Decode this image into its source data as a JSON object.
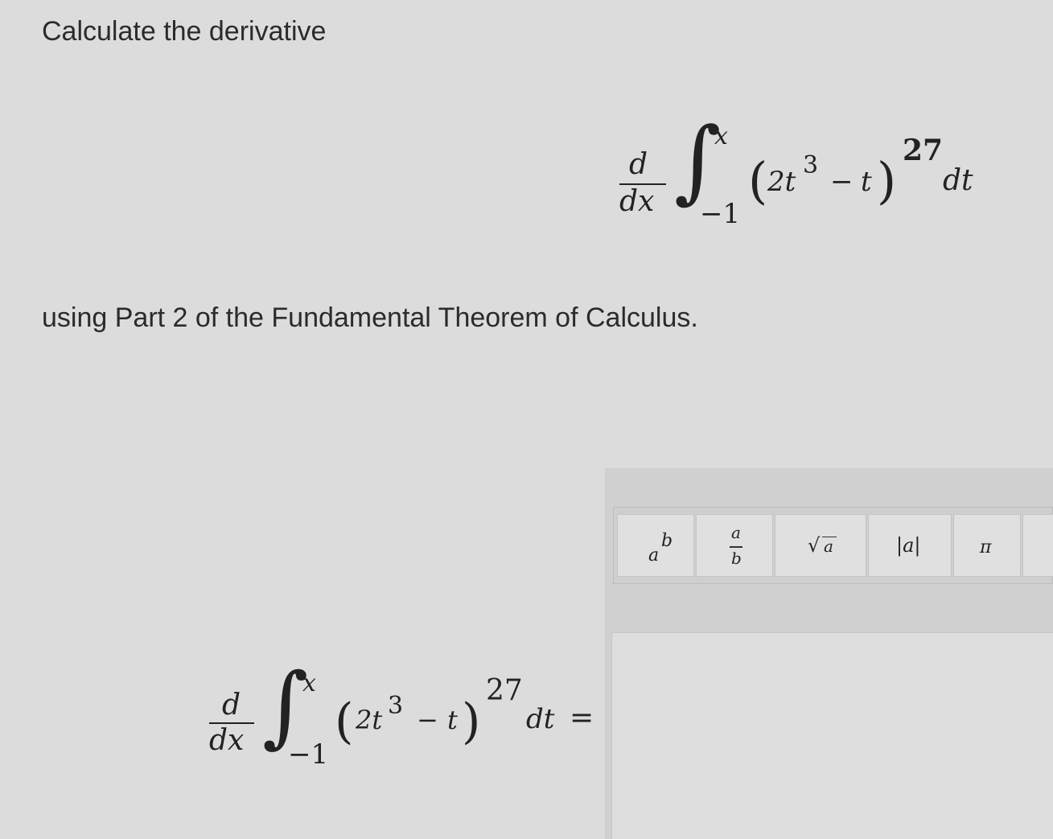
{
  "question": {
    "heading": "Calculate the derivative",
    "instruction": "using Part 2 of the Fundamental Theorem of Calculus."
  },
  "expression": {
    "derivative_num": "d",
    "derivative_den": "dx",
    "integral_sign": "∫",
    "upper_limit": "x",
    "lower_limit": "−1",
    "open_paren": "(",
    "coefficient": "2t",
    "power": "3",
    "minus": "−",
    "variable": "t",
    "close_paren": ")",
    "exponent": "27",
    "differential": "dt",
    "equals": "="
  },
  "toolbar": {
    "power": {
      "base": "a",
      "exp": "b"
    },
    "fraction": {
      "num": "a",
      "den": "b"
    },
    "sqrt": {
      "symbol": "√",
      "arg": "a"
    },
    "abs": {
      "label": "|a|"
    },
    "pi": {
      "label": "π"
    }
  },
  "answer": {
    "value": ""
  }
}
